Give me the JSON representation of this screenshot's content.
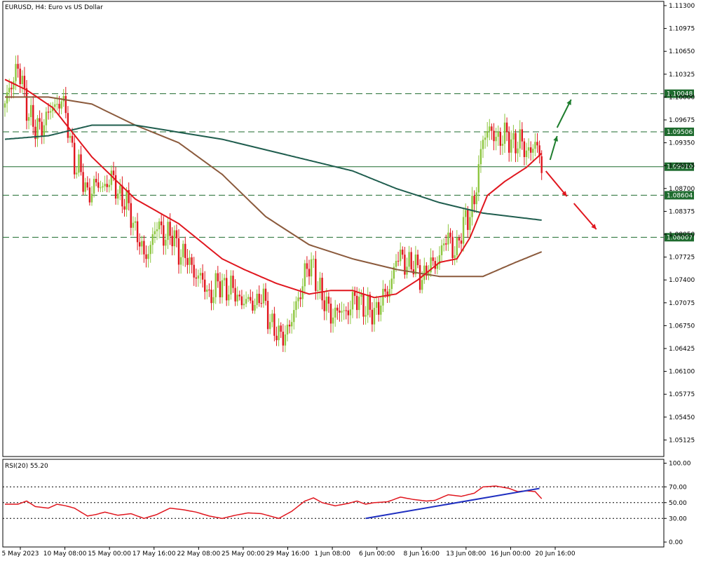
{
  "chart_data": [
    {
      "type": "candlestick",
      "title": "EURUSD, H4:  Euro vs US Dollar",
      "ylim": [
        1.0495,
        1.1145
      ],
      "y_ticks": [
        "1.11300",
        "1.10975",
        "1.10650",
        "1.10325",
        "1.10000",
        "1.09675",
        "1.09350",
        "1.09025",
        "1.08700",
        "1.08375",
        "1.08050",
        "1.07725",
        "1.07400",
        "1.07075",
        "1.06750",
        "1.06425",
        "1.06100",
        "1.05775",
        "1.05450",
        "1.05125"
      ],
      "x_ticks": [
        "5 May 2023",
        "10 May 08:00",
        "15 May 00:00",
        "17 May 16:00",
        "22 May 08:00",
        "25 May 00:00",
        "29 May 16:00",
        "1 Jun 08:00",
        "6 Jun 00:00",
        "8 Jun 16:00",
        "13 Jun 08:00",
        "16 Jun 00:00",
        "20 Jun 16:00"
      ],
      "colors": {
        "bull": "#8dc63f",
        "bear": "#e0161e",
        "ma_fast": "#e0161e",
        "ma_medium": "#1f5d4e",
        "ma_slow": "#8b5a3c",
        "level_line": "#1e6b2e",
        "arrow_up": "#1e7d2e",
        "arrow_down": "#e0161e"
      },
      "price_levels": [
        {
          "value": 1.10048,
          "label": "1.10048",
          "style": "dashed"
        },
        {
          "value": 1.09506,
          "label": "1.09506",
          "style": "dashed"
        },
        {
          "value": 1.0901,
          "label": "1.09010",
          "style": "solid"
        },
        {
          "value": 1.08604,
          "label": "1.08604",
          "style": "dashed"
        },
        {
          "value": 1.08007,
          "label": "1.08007",
          "style": "dashed"
        }
      ],
      "anchors": [
        [
          0,
          1.0985
        ],
        [
          3,
          1.1025
        ],
        [
          6,
          1.104
        ],
        [
          10,
          1.099
        ],
        [
          14,
          1.095
        ],
        [
          20,
          1.0975
        ],
        [
          26,
          1.1
        ],
        [
          32,
          1.091
        ],
        [
          38,
          1.0865
        ],
        [
          44,
          1.0875
        ],
        [
          50,
          1.088
        ],
        [
          54,
          1.0855
        ],
        [
          58,
          1.0835
        ],
        [
          64,
          1.077
        ],
        [
          70,
          1.0815
        ],
        [
          77,
          1.08
        ],
        [
          82,
          1.0775
        ],
        [
          88,
          1.075
        ],
        [
          94,
          1.072
        ],
        [
          100,
          1.0735
        ],
        [
          106,
          1.072
        ],
        [
          112,
          1.0705
        ],
        [
          118,
          1.0715
        ],
        [
          126,
          1.0655
        ],
        [
          132,
          1.068
        ],
        [
          138,
          1.075
        ],
        [
          142,
          1.076
        ],
        [
          146,
          1.071
        ],
        [
          152,
          1.069
        ],
        [
          158,
          1.07
        ],
        [
          163,
          1.0715
        ],
        [
          168,
          1.069
        ],
        [
          172,
          1.0705
        ],
        [
          176,
          1.072
        ],
        [
          180,
          1.077
        ],
        [
          186,
          1.0765
        ],
        [
          192,
          1.0745
        ],
        [
          198,
          1.0765
        ],
        [
          204,
          1.08
        ],
        [
          208,
          1.078
        ],
        [
          212,
          1.083
        ],
        [
          216,
          1.0845
        ],
        [
          220,
          1.095
        ],
        [
          226,
          1.0945
        ],
        [
          232,
          1.094
        ],
        [
          236,
          1.0935
        ],
        [
          240,
          1.0925
        ],
        [
          244,
          1.093
        ],
        [
          247,
          1.0905
        ]
      ],
      "ma_fast": [
        [
          0,
          1.1025
        ],
        [
          10,
          1.101
        ],
        [
          22,
          1.0985
        ],
        [
          40,
          1.0915
        ],
        [
          60,
          1.0855
        ],
        [
          80,
          1.082
        ],
        [
          100,
          1.077
        ],
        [
          110,
          1.0755
        ],
        [
          125,
          1.0735
        ],
        [
          140,
          1.072
        ],
        [
          150,
          1.0725
        ],
        [
          160,
          1.0725
        ],
        [
          170,
          1.0715
        ],
        [
          180,
          1.072
        ],
        [
          190,
          1.074
        ],
        [
          200,
          1.0765
        ],
        [
          208,
          1.077
        ],
        [
          214,
          1.08
        ],
        [
          222,
          1.086
        ],
        [
          230,
          1.088
        ],
        [
          240,
          1.09
        ],
        [
          247,
          1.092
        ]
      ],
      "ma_medium": [
        [
          0,
          1.094
        ],
        [
          20,
          1.0945
        ],
        [
          40,
          1.096
        ],
        [
          60,
          1.096
        ],
        [
          80,
          1.095
        ],
        [
          100,
          1.094
        ],
        [
          120,
          1.0925
        ],
        [
          140,
          1.091
        ],
        [
          160,
          1.0895
        ],
        [
          180,
          1.087
        ],
        [
          200,
          1.085
        ],
        [
          220,
          1.0835
        ],
        [
          247,
          1.0825
        ]
      ],
      "ma_slow": [
        [
          0,
          1.1
        ],
        [
          20,
          1.1
        ],
        [
          40,
          1.099
        ],
        [
          60,
          1.096
        ],
        [
          80,
          1.0935
        ],
        [
          100,
          1.089
        ],
        [
          120,
          1.083
        ],
        [
          140,
          1.079
        ],
        [
          160,
          1.077
        ],
        [
          180,
          1.0755
        ],
        [
          200,
          1.0745
        ],
        [
          220,
          1.0745
        ],
        [
          235,
          1.0765
        ],
        [
          247,
          1.078
        ]
      ]
    },
    {
      "type": "line",
      "title": "RSI(20) 55.20",
      "ylim": [
        0,
        100
      ],
      "y_ticks": [
        "100.00",
        "70.00",
        "50.00",
        "30.00",
        "0.00"
      ],
      "levels": [
        70,
        50,
        30
      ],
      "colors": {
        "rsi": "#e0161e",
        "trend": "#1f2fc0"
      },
      "rsi": [
        [
          0,
          48
        ],
        [
          6,
          48
        ],
        [
          10,
          52
        ],
        [
          14,
          45
        ],
        [
          20,
          43
        ],
        [
          24,
          48
        ],
        [
          28,
          46
        ],
        [
          32,
          43
        ],
        [
          38,
          33
        ],
        [
          42,
          35
        ],
        [
          46,
          38
        ],
        [
          52,
          34
        ],
        [
          58,
          36
        ],
        [
          64,
          30
        ],
        [
          70,
          35
        ],
        [
          76,
          43
        ],
        [
          82,
          41
        ],
        [
          88,
          38
        ],
        [
          94,
          33
        ],
        [
          100,
          30
        ],
        [
          106,
          34
        ],
        [
          112,
          37
        ],
        [
          118,
          36
        ],
        [
          126,
          30
        ],
        [
          132,
          39
        ],
        [
          138,
          52
        ],
        [
          142,
          56
        ],
        [
          146,
          50
        ],
        [
          152,
          46
        ],
        [
          158,
          49
        ],
        [
          162,
          52
        ],
        [
          166,
          48
        ],
        [
          170,
          50
        ],
        [
          176,
          51
        ],
        [
          182,
          57
        ],
        [
          188,
          54
        ],
        [
          194,
          52
        ],
        [
          198,
          53
        ],
        [
          204,
          60
        ],
        [
          210,
          58
        ],
        [
          216,
          62
        ],
        [
          220,
          70
        ],
        [
          226,
          71
        ],
        [
          232,
          68
        ],
        [
          236,
          64
        ],
        [
          240,
          65
        ],
        [
          244,
          64
        ],
        [
          247,
          55
        ]
      ],
      "trendline": [
        [
          166,
          30
        ],
        [
          246,
          68
        ]
      ]
    }
  ]
}
